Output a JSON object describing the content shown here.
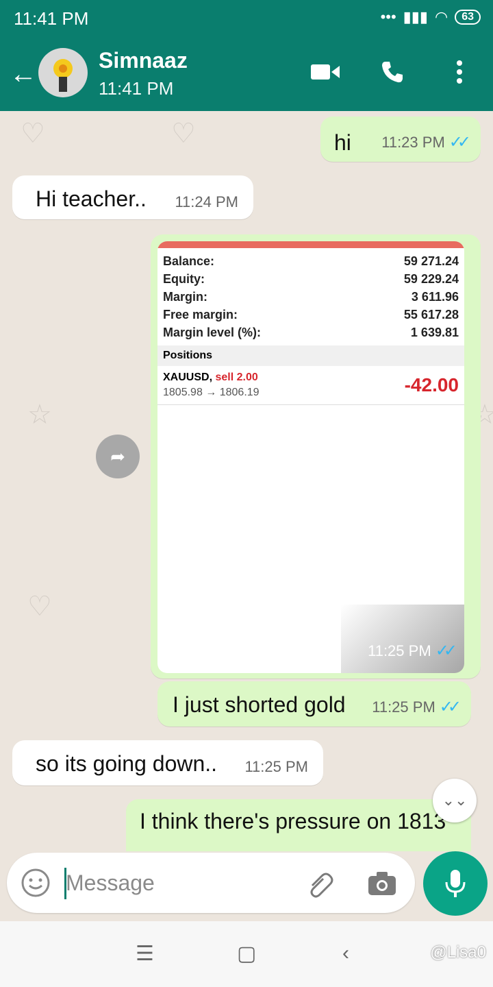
{
  "status_bar": {
    "time": "11:41 PM",
    "signal": "•••",
    "battery": "63"
  },
  "header": {
    "contact_name": "Simnaaz",
    "contact_status": "11:41 PM"
  },
  "messages": [
    {
      "text": "hi",
      "time": "11:23 PM",
      "direction": "out"
    },
    {
      "text": "Hi teacher..",
      "time": "11:24 PM",
      "direction": "in"
    },
    {
      "image_time": "11:25 PM",
      "direction": "out"
    },
    {
      "text": "I just shorted gold",
      "time": "11:25 PM",
      "direction": "out"
    },
    {
      "text": "so its going down..",
      "time": "11:25 PM",
      "direction": "in"
    },
    {
      "text": "I think there's pressure on 1813",
      "direction": "out"
    }
  ],
  "trade_screenshot": {
    "accounts": [
      {
        "label": "Balance:",
        "value": "59 271.24"
      },
      {
        "label": "Equity:",
        "value": "59 229.24"
      },
      {
        "label": "Margin:",
        "value": "3 611.96"
      },
      {
        "label": "Free margin:",
        "value": "55 617.28"
      },
      {
        "label": "Margin level (%):",
        "value": "1 639.81"
      }
    ],
    "positions_title": "Positions",
    "position": {
      "symbol": "XAUUSD,",
      "side": "sell 2.00",
      "prices": "1805.98 → 1806.19",
      "pl": "-42.00"
    }
  },
  "input": {
    "placeholder": "Message"
  },
  "watermark": "@Lisa0",
  "colors": {
    "header": "#0a7e6e",
    "out_bubble": "#dcf8c6",
    "in_bubble": "#ffffff",
    "mic": "#0aa487",
    "loss": "#d7262d"
  }
}
